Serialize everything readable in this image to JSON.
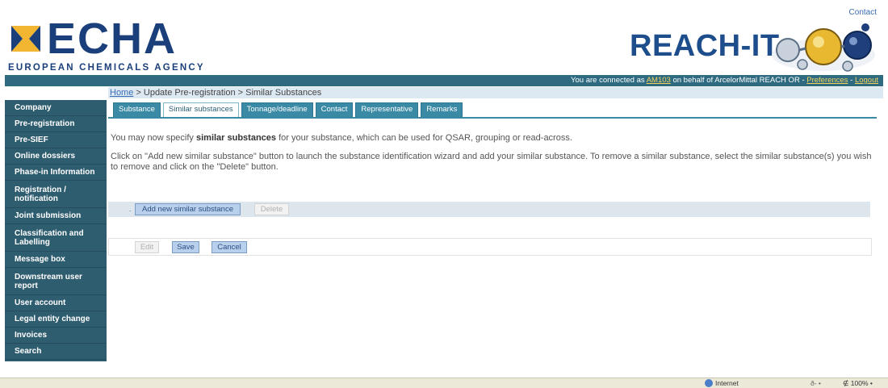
{
  "header": {
    "logo_text": "ECHA",
    "logo_subtitle": "EUROPEAN CHEMICALS AGENCY",
    "contact_link": "Contact",
    "app_title": "REACH-IT"
  },
  "status_bar": {
    "prefix": "You are connected as ",
    "user": "AM103",
    "middle": " on behalf of ArcelorMittal REACH OR - ",
    "preferences": "Preferences",
    "separator": " - ",
    "logout": "Logout"
  },
  "sidebar": {
    "items": [
      {
        "label": "Company",
        "lines": 1
      },
      {
        "label": "Pre-registration",
        "lines": 1
      },
      {
        "label": "Pre-SIEF",
        "lines": 1
      },
      {
        "label": "Online dossiers",
        "lines": 1
      },
      {
        "label": "Phase-in Information",
        "lines": 1
      },
      {
        "label": "Registration / notification",
        "lines": 2
      },
      {
        "label": "Joint submission",
        "lines": 1
      },
      {
        "label": "Classification and Labelling",
        "lines": 2
      },
      {
        "label": "Message box",
        "lines": 1
      },
      {
        "label": "Downstream user report",
        "lines": 2
      },
      {
        "label": "User account",
        "lines": 1
      },
      {
        "label": "Legal entity change",
        "lines": 1
      },
      {
        "label": "Invoices",
        "lines": 1
      },
      {
        "label": "Search",
        "lines": 1
      }
    ]
  },
  "breadcrumb": {
    "home": "Home",
    "rest": " > Update Pre-registration > Similar Substances"
  },
  "tabs": [
    {
      "label": "Substance",
      "active": false
    },
    {
      "label": "Similar substances",
      "active": true
    },
    {
      "label": "Tonnage/deadline",
      "active": false
    },
    {
      "label": "Contact",
      "active": false
    },
    {
      "label": "Representative",
      "active": false
    },
    {
      "label": "Remarks",
      "active": false
    }
  ],
  "intro": {
    "before": "You may now specify ",
    "bold": "similar substances",
    "after": " for your substance, which can be used for QSAR, grouping or read-across."
  },
  "instructions": "Click on \"Add new similar substance\" button to launch the substance identification wizard and add your similar substance. To remove a similar substance, select the similar substance(s) you wish to remove and click on the \"Delete\" button.",
  "actions": {
    "add_label": "Add new similar substance",
    "delete_label": "Delete",
    "edit_label": "Edit",
    "save_label": "Save",
    "cancel_label": "Cancel"
  },
  "browser_status": {
    "zone": "Internet",
    "protected_mode": "ð‑ •",
    "zoom": "∉ 100%  •"
  },
  "colors": {
    "sidebar_bg": "#2f5d70",
    "status_bar_bg": "#2e6b80",
    "tab_bg": "#3a8aa6",
    "logo_blue": "#1b3f7a",
    "button_bg": "#b9d0ec"
  }
}
